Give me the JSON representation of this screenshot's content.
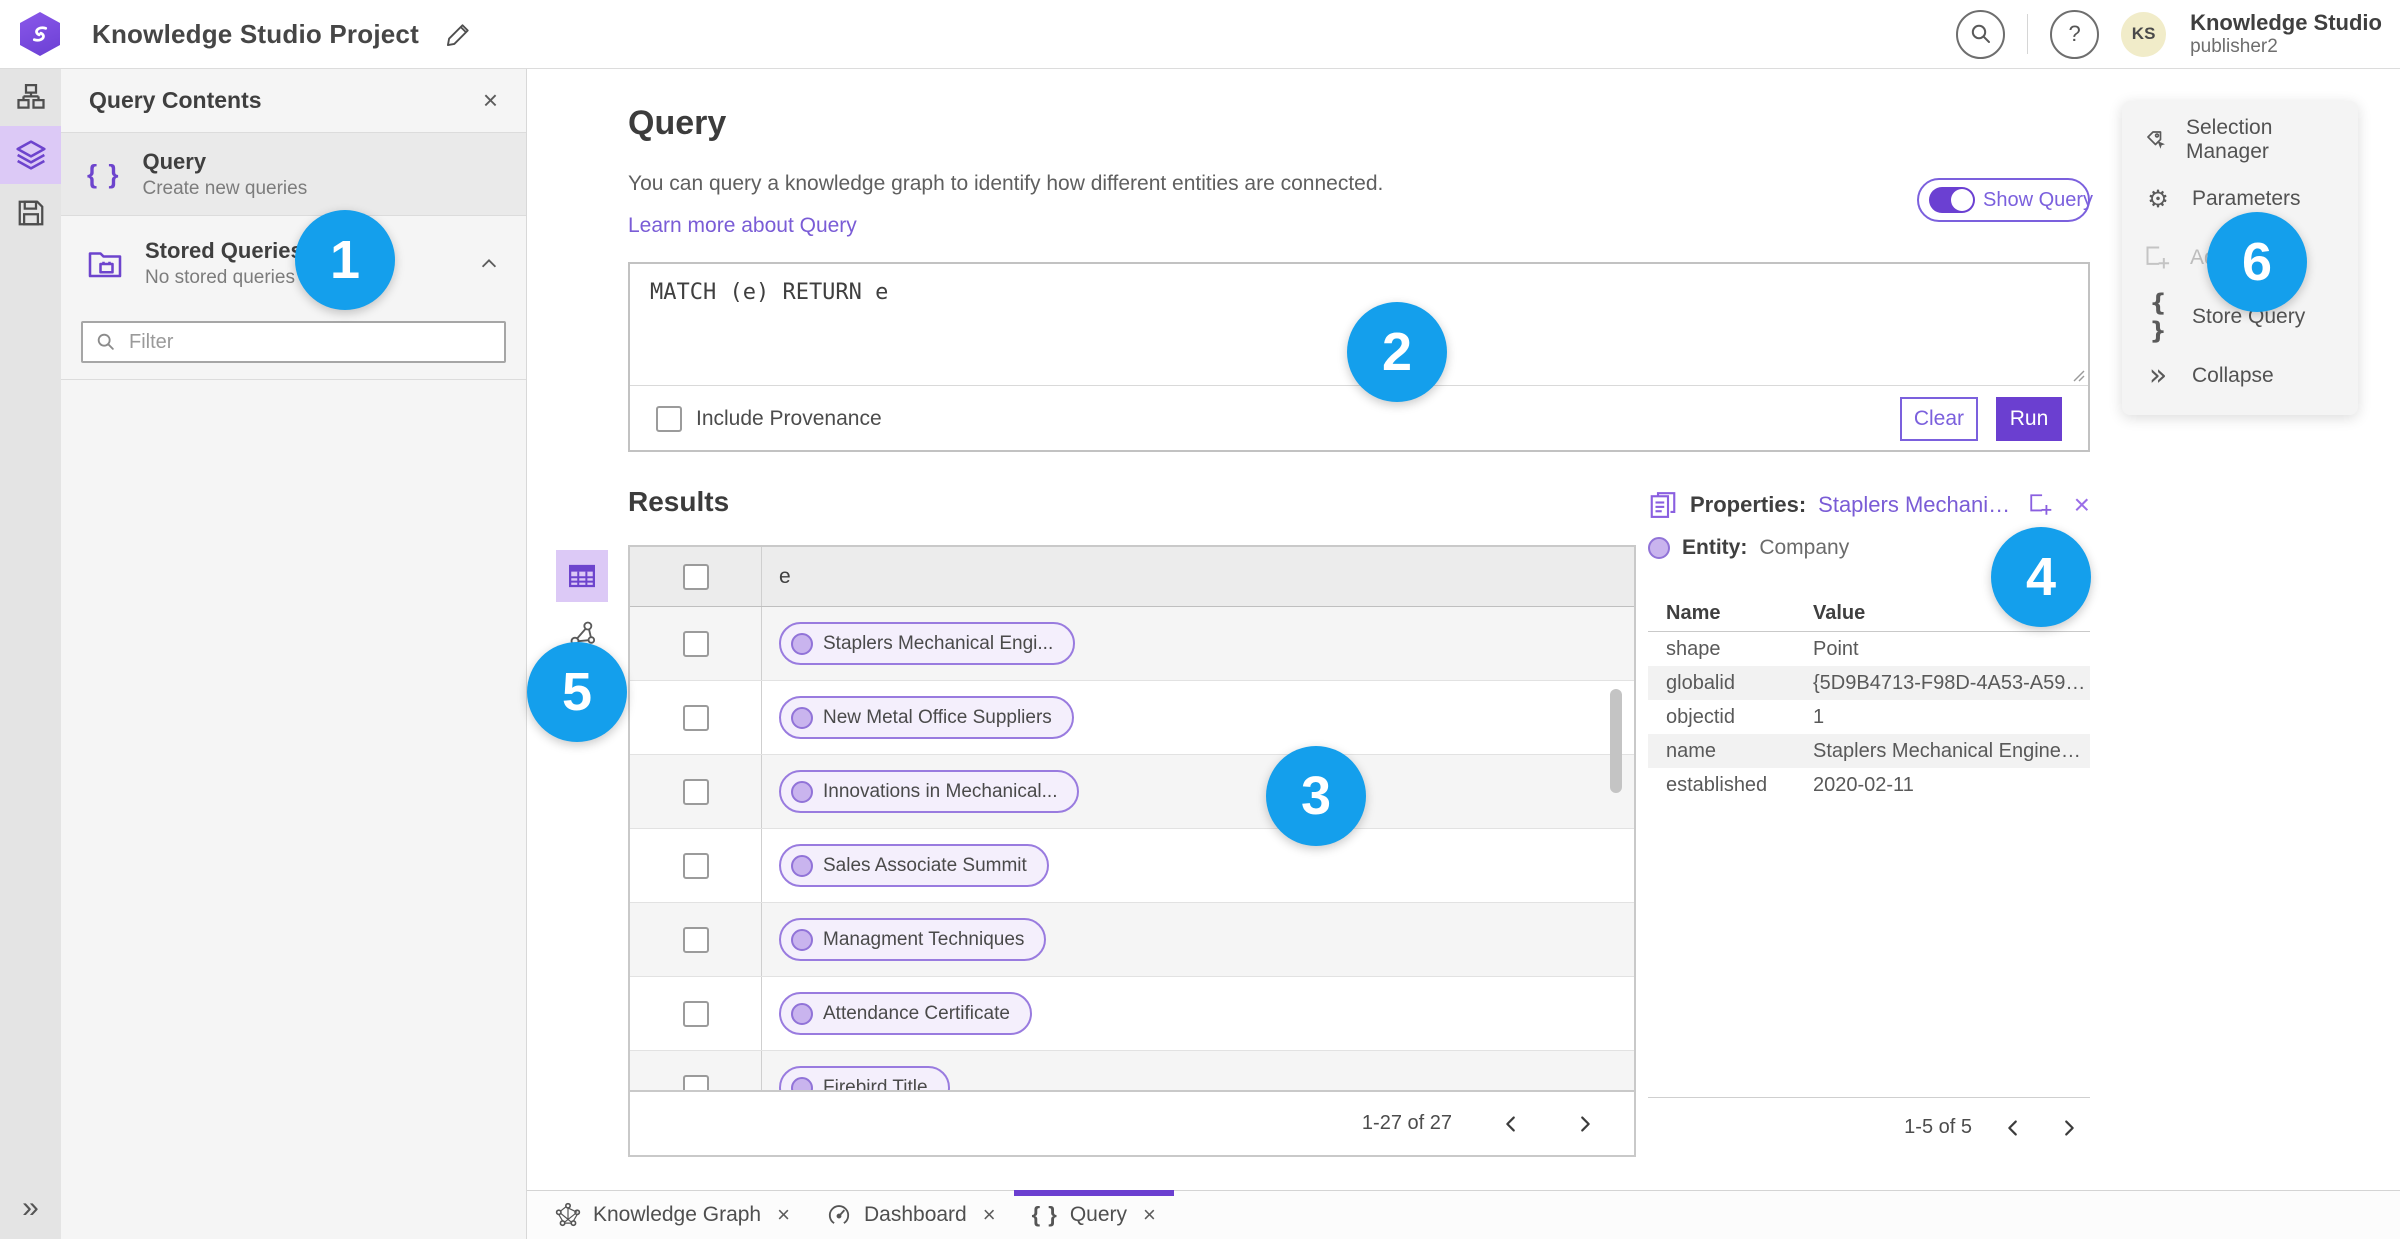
{
  "colors": {
    "accent_purple": "#6b40d2",
    "link_purple": "#7a5cd6",
    "badge_blue": "#149fec",
    "chip_border": "#997bdf",
    "chip_fill": "#f4effc",
    "rail_selected": "#dcc9f6",
    "avatar_bg": "#f1ecc9"
  },
  "glyphs": {
    "braces": "{ }",
    "close": "×",
    "question": "?",
    "gear": "⚙",
    "double_chevron": "»"
  },
  "header": {
    "title": "Knowledge Studio Project",
    "user_name": "Knowledge Studio",
    "user_role": "publisher2",
    "avatar_initials": "KS"
  },
  "contents_panel": {
    "title": "Query Contents",
    "query_item": {
      "title": "Query",
      "subtitle": "Create new queries"
    },
    "stored_item": {
      "title": "Stored Queries",
      "subtitle": "No stored queries exist"
    },
    "filter_placeholder": "Filter"
  },
  "query_section": {
    "heading": "Query",
    "description": "You can query a knowledge graph to identify how different entities are connected.",
    "learn_more": "Learn more about Query",
    "show_query": "Show Query",
    "query_text": "MATCH (e) RETURN e",
    "include_provenance": "Include Provenance",
    "clear": "Clear",
    "run": "Run"
  },
  "results": {
    "heading": "Results",
    "column": "e",
    "rows": [
      "Staplers Mechanical Engi...",
      "New Metal Office Suppliers",
      "Innovations in Mechanical...",
      "Sales Associate Summit",
      "Managment Techniques",
      "Attendance Certificate",
      "Firebird Title"
    ],
    "pagination": "1-27 of 27"
  },
  "properties": {
    "label": "Properties:",
    "entity_link": "Staplers Mechanic...",
    "entity_label": "Entity:",
    "entity_type": "Company",
    "col_name": "Name",
    "col_value": "Value",
    "rows": [
      {
        "name": "shape",
        "value": "Point"
      },
      {
        "name": "globalid",
        "value": "{5D9B4713-F98D-4A53-A59F-C11..."
      },
      {
        "name": "objectid",
        "value": "1"
      },
      {
        "name": "name",
        "value": "Staplers Mechanical Engineering"
      },
      {
        "name": "established",
        "value": "2020-02-11"
      }
    ],
    "pagination": "1-5 of 5"
  },
  "tools_menu": {
    "items": [
      {
        "label": "Selection Manager",
        "icon": "tag-cursor",
        "disabled": false
      },
      {
        "label": "Parameters",
        "icon": "gear",
        "disabled": false
      },
      {
        "label": "Ad",
        "icon": "add-new",
        "disabled": true
      },
      {
        "label": "Store Query",
        "icon": "braces",
        "disabled": false
      },
      {
        "label": "Collapse",
        "icon": "double-chevron",
        "disabled": false
      }
    ]
  },
  "tabs": [
    {
      "label": "Knowledge Graph",
      "icon": "graph",
      "active": false
    },
    {
      "label": "Dashboard",
      "icon": "gauge",
      "active": false
    },
    {
      "label": "Query",
      "icon": "braces",
      "active": true
    }
  ],
  "badges": [
    "1",
    "2",
    "3",
    "4",
    "5",
    "6"
  ]
}
